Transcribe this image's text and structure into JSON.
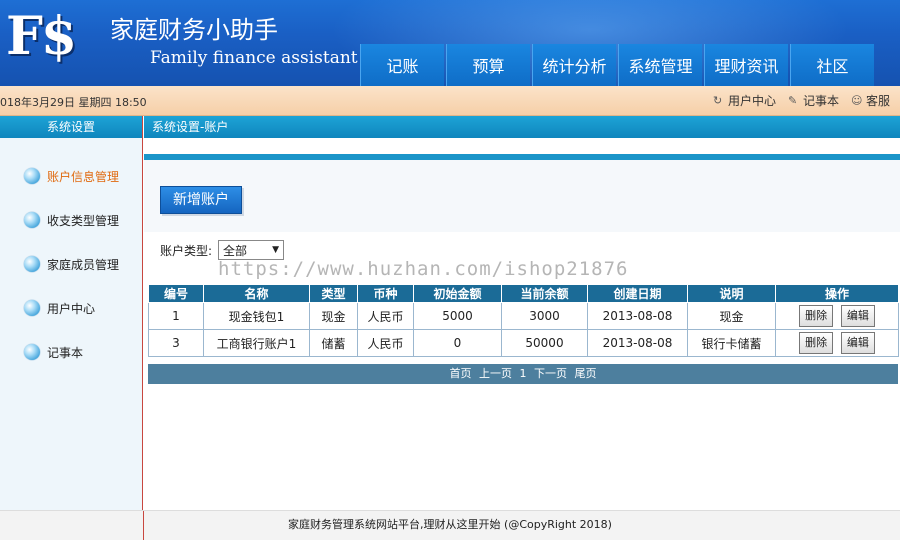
{
  "header": {
    "logo": "F$",
    "title": "家庭财务小助手",
    "subtitle": "Family finance assistant",
    "nav": [
      "记账",
      "预算",
      "统计分析",
      "系统管理",
      "理财资讯",
      "社区"
    ]
  },
  "infobar": {
    "datetime": "018年3月29日 星期四 18:50",
    "links": [
      {
        "label": "用户中心",
        "icon": "user-center-icon"
      },
      {
        "label": "记事本",
        "icon": "notepad-icon"
      },
      {
        "label": "客服",
        "icon": "service-icon"
      }
    ]
  },
  "sidebar": {
    "title": "系统设置",
    "items": [
      "账户信息管理",
      "收支类型管理",
      "家庭成员管理",
      "用户中心",
      "记事本"
    ]
  },
  "main": {
    "breadcrumb": "系统设置-账户",
    "add_button": "新增账户",
    "filter_label": "账户类型:",
    "filter_value": "全部",
    "watermark": "https://www.huzhan.com/ishop21876",
    "columns": [
      "编号",
      "名称",
      "类型",
      "币种",
      "初始金额",
      "当前余额",
      "创建日期",
      "说明",
      "操作"
    ],
    "rows": [
      [
        "1",
        "现金钱包1",
        "现金",
        "人民币",
        "5000",
        "3000",
        "2013-08-08",
        "现金"
      ],
      [
        "3",
        "工商银行账户1",
        "储蓄",
        "人民币",
        "0",
        "50000",
        "2013-08-08",
        "银行卡储蓄"
      ]
    ],
    "delete_label": "删除",
    "edit_label": "编辑",
    "pager": {
      "first": "首页",
      "prev": "上一页",
      "page": "1",
      "next": "下一页",
      "last": "尾页"
    }
  },
  "footer": {
    "text": "家庭财务管理系统网站平台,理财从这里开始 (@CopyRight 2018)"
  },
  "colors": {
    "header_blue": "#1a5fc4",
    "section_teal": "#0f86bd",
    "table_head": "#1b6b97",
    "active_orange": "#e06a10"
  }
}
